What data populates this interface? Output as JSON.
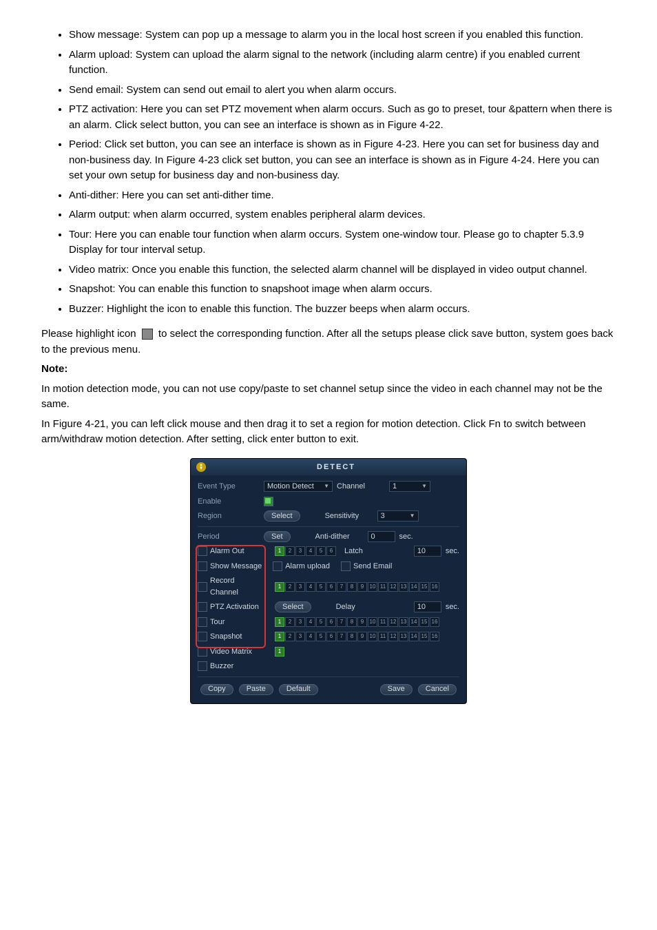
{
  "bullets": [
    "Show message: System can pop up a message to alarm you in the local host screen if you enabled this function.",
    "Alarm upload: System can upload the alarm signal to the network (including alarm centre) if you enabled current function.",
    "Send email: System can send out email to alert you when alarm occurs.",
    "PTZ activation: Here you can set PTZ movement when alarm occurs. Such as go to preset, tour &pattern when there is an alarm. Click   select   button, you can see an interface is shown as in Figure 4-22.",
    "Period: Click set button, you can see an interface is shown as in Figure 4-23. Here you can set for business day and non-business day. In Figure 4-23 click set button, you can see an interface is shown as in Figure 4-24. Here you can set your own setup for business day and non-business day.",
    "Anti-dither: Here you can set anti-dither time.",
    "Alarm output: when alarm occurred, system enables peripheral alarm devices.",
    "Tour: Here you can enable tour function when alarm occurs.  System one-window tour. Please go to chapter 5.3.9 Display for tour interval setup.",
    "Video matrix: Once you enable this function, the selected alarm channel will be displayed in video output channel.",
    "Snapshot: You can enable this function to snapshoot image when alarm occurs.",
    "Buzzer: Highlight the icon to enable this function. The buzzer beeps when alarm occurs."
  ],
  "para1_pre": "Please highlight icon ",
  "para1_post": " to select the corresponding function. After all the setups please click save button, system goes back to the previous menu.",
  "note_label": "Note:",
  "note1": "In motion detection mode, you can not use copy/paste to set channel setup since the video in each channel may not be the same.",
  "note2": "In Figure 4-21, you can left click mouse and then drag it to set a region for motion detection. Click Fn to switch between arm/withdraw motion detection. After setting, click enter button to exit.",
  "dialog": {
    "title": "DETECT",
    "event_type_label": "Event Type",
    "event_type_value": "Motion Detect",
    "channel_label": "Channel",
    "channel_value": "1",
    "enable_label": "Enable",
    "region_label": "Region",
    "select_btn": "Select",
    "sensitivity_label": "Sensitivity",
    "sensitivity_value": "3",
    "period_label": "Period",
    "set_btn": "Set",
    "anti_dither_label": "Anti-dither",
    "anti_dither_value": "0",
    "sec_label": "sec.",
    "alarm_out_label": "Alarm Out",
    "latch_label": "Latch",
    "latch_value": "10",
    "show_message_label": "Show Message",
    "alarm_upload_label": "Alarm upload",
    "send_email_label": "Send Email",
    "record_channel_label": "Record Channel",
    "ptz_activation_label": "PTZ Activation",
    "delay_label": "Delay",
    "delay_value": "10",
    "tour_label": "Tour",
    "snapshot_label": "Snapshot",
    "video_matrix_label": "Video Matrix",
    "buzzer_label": "Buzzer",
    "copy_btn": "Copy",
    "paste_btn": "Paste",
    "default_btn": "Default",
    "save_btn": "Save",
    "cancel_btn": "Cancel"
  }
}
